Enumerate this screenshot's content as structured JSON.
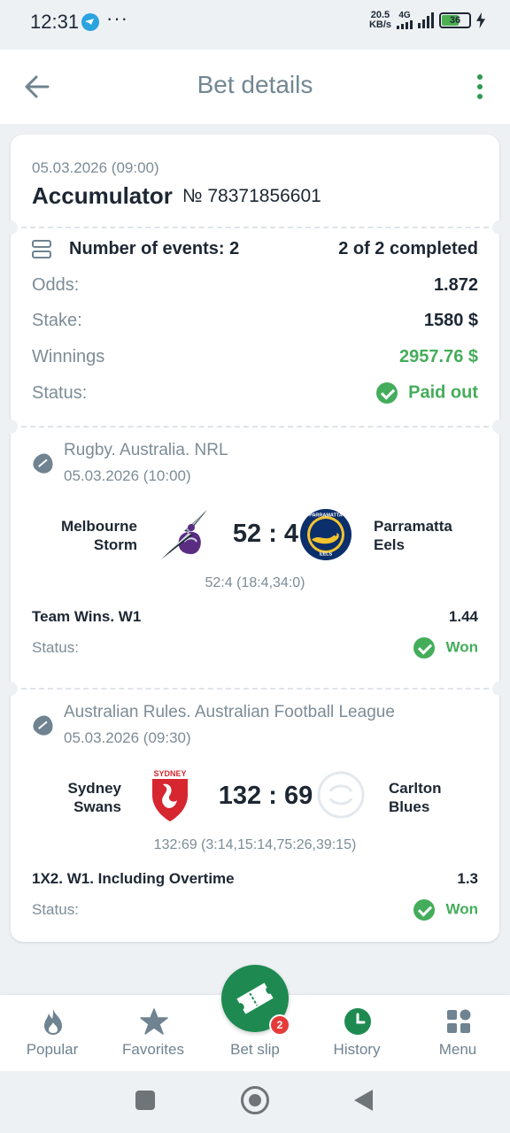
{
  "status_bar": {
    "time": "12:31",
    "speed": "20.5",
    "speed_unit": "KB/s",
    "network": "4G",
    "battery": "36"
  },
  "header": {
    "title": "Bet details"
  },
  "bet": {
    "date": "05.03.2026 (09:00)",
    "type": "Accumulator",
    "number": "№ 78371856601",
    "events_label": "Number of events: 2",
    "completed": "2 of 2 completed",
    "odds_label": "Odds:",
    "odds_value": "1.872",
    "stake_label": "Stake:",
    "stake_value": "1580 $",
    "winnings_label": "Winnings",
    "winnings_value": "2957.76 $",
    "status_label": "Status:",
    "status_value": "Paid out"
  },
  "events": [
    {
      "league": "Rugby. Australia. NRL",
      "date": "05.03.2026 (10:00)",
      "home_line1": "Melbourne",
      "home_line2": "Storm",
      "away_line1": "Parramatta",
      "away_line2": "Eels",
      "score": "52 : 4",
      "detail": "52:4 (18:4,34:0)",
      "market": "Team Wins. W1",
      "odds": "1.44",
      "status_label": "Status:",
      "status_value": "Won",
      "home_logo_text": "",
      "away_logo_text": "PARRAMATTA"
    },
    {
      "league": "Australian Rules. Australian Football League",
      "date": "05.03.2026 (09:30)",
      "home_line1": "Sydney",
      "home_line2": "Swans",
      "away_line1": "Carlton",
      "away_line2": "Blues",
      "score": "132 : 69",
      "detail": "132:69 (3:14,15:14,75:26,39:15)",
      "market": "1X2. W1. Including Overtime",
      "odds": "1.3",
      "status_label": "Status:",
      "status_value": "Won",
      "home_logo_text": "SYDNEY"
    }
  ],
  "nav": {
    "items": [
      {
        "label": "Popular",
        "icon": "flame-icon"
      },
      {
        "label": "Favorites",
        "icon": "star-icon"
      },
      {
        "label": "Bet slip",
        "icon": "ticket-icon"
      },
      {
        "label": "History",
        "icon": "clock-icon"
      },
      {
        "label": "Menu",
        "icon": "grid-icon"
      }
    ],
    "badge": "2",
    "active": "History"
  },
  "colors": {
    "accent": "#44ad5b",
    "brand": "#1e8a51",
    "muted": "#7d8c96",
    "badge": "#e63a3a"
  }
}
